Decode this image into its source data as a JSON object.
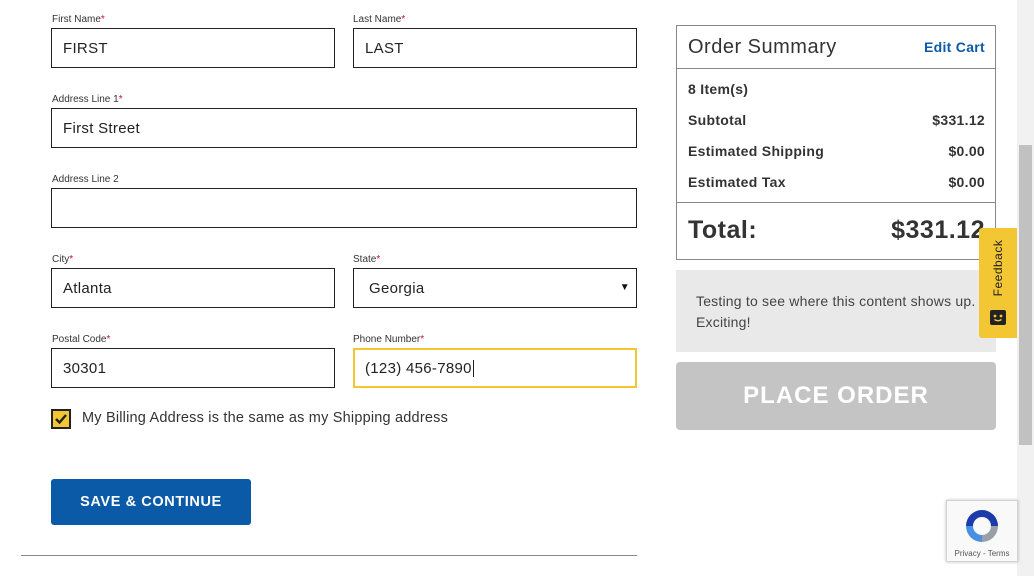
{
  "form": {
    "first_name": {
      "label": "First Name",
      "required_mark": "*",
      "value": "FIRST"
    },
    "last_name": {
      "label": "Last Name",
      "required_mark": "*",
      "value": "LAST"
    },
    "address1": {
      "label": "Address Line 1",
      "required_mark": "*",
      "value": "First Street"
    },
    "address2": {
      "label": "Address Line 2",
      "value": ""
    },
    "city": {
      "label": "City",
      "required_mark": "*",
      "value": "Atlanta"
    },
    "state": {
      "label": "State",
      "required_mark": "*",
      "value": "Georgia",
      "arrow": "▼"
    },
    "postal": {
      "label": "Postal Code",
      "required_mark": "*",
      "value": "30301"
    },
    "phone": {
      "label": "Phone Number",
      "required_mark": "*",
      "value": "(123) 456-7890"
    },
    "billing_same": {
      "label": "My Billing Address is the same as my Shipping address",
      "checked": true
    },
    "save_button": "SAVE & CONTINUE"
  },
  "summary": {
    "title": "Order Summary",
    "edit_cart": "Edit Cart",
    "items": "8 Item(s)",
    "subtotal_label": "Subtotal",
    "subtotal_value": "$331.12",
    "shipping_label": "Estimated Shipping",
    "shipping_value": "$0.00",
    "tax_label": "Estimated Tax",
    "tax_value": "$0.00",
    "total_label": "Total:",
    "total_value": "$331.12"
  },
  "notice": "Testing to see where this content shows up. Exciting!",
  "place_order": "PLACE ORDER",
  "feedback": "Feedback",
  "recaptcha": {
    "terms": "Privacy - Terms"
  },
  "colors": {
    "accent_yellow": "#f3c634",
    "primary_blue": "#0a5aa7",
    "disabled_gray": "#c4c4c4"
  }
}
